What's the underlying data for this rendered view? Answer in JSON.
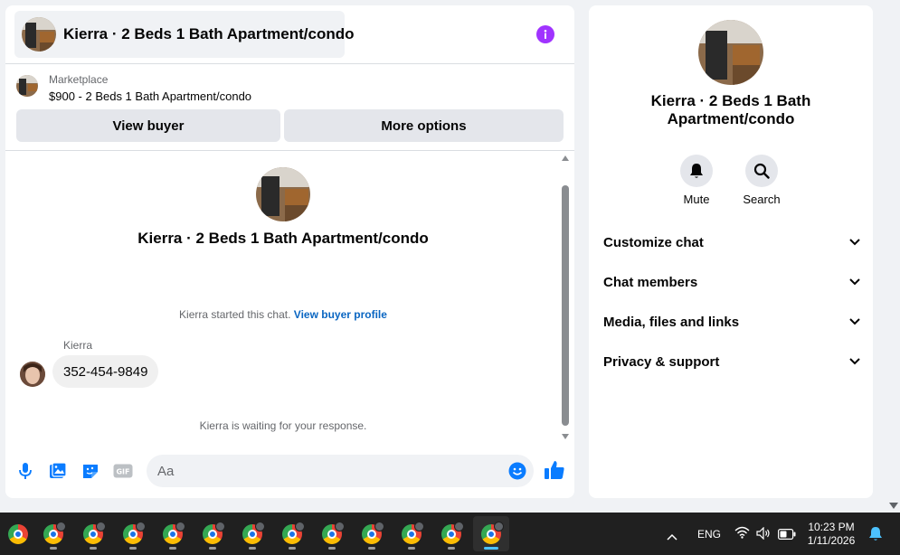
{
  "chat": {
    "header_title": "Kierra · 2 Beds 1 Bath Apartment/condo",
    "listing_source": "Marketplace",
    "listing_title": "$900 - 2 Beds 1 Bath Apartment/condo",
    "view_buyer_label": "View buyer",
    "more_options_label": "More options",
    "thread_title": "Kierra · 2 Beds 1 Bath Apartment/condo",
    "started_text": "Kierra started this chat.",
    "view_profile_link": "View buyer profile",
    "sender_name": "Kierra",
    "message_text": "352-454-9849",
    "waiting_text": "Kierra is waiting for your response.",
    "composer_placeholder": "Aa"
  },
  "side": {
    "title_line1": "Kierra · 2 Beds 1 Bath",
    "title_line2": "Apartment/condo",
    "mute_label": "Mute",
    "search_label": "Search",
    "rows": [
      "Customize chat",
      "Chat members",
      "Media, files and links",
      "Privacy & support"
    ]
  },
  "taskbar": {
    "language": "ENG",
    "time": "10:23 PM",
    "date": "1/11/2026"
  },
  "colors": {
    "accent_blue": "#0a7cff",
    "info_purple": "#a033ff",
    "link_blue": "#0a66c2"
  }
}
